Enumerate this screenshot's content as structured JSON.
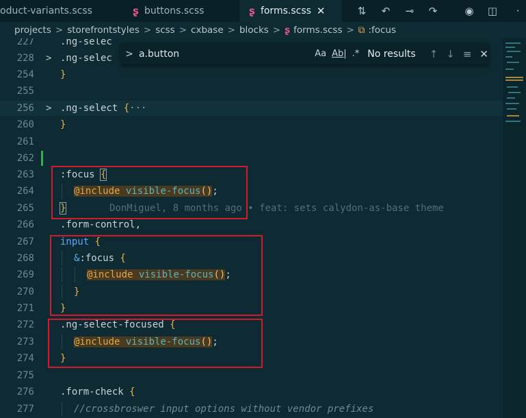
{
  "tabs": [
    {
      "label": "oduct-variants.scss"
    },
    {
      "label": "buttons.scss"
    },
    {
      "label": "forms.scss",
      "close": "✕"
    }
  ],
  "breadcrumb": [
    "projects",
    "storefrontstyles",
    "scss",
    "cxbase",
    "blocks",
    "forms.scss",
    ":focus"
  ],
  "find": {
    "query": "a.button",
    "opt_case": "Aa",
    "opt_word": "Ab|",
    "opt_regex": ".*",
    "results": "No results"
  },
  "lines": {
    "l227": {
      "num": "227",
      "text": ".ng-selec"
    },
    "l228": {
      "num": "228",
      "text": ".ng-selec"
    },
    "l254": {
      "num": "254",
      "text": "}"
    },
    "l255": {
      "num": "255"
    },
    "l256": {
      "num": "256",
      "sel": ".ng-select",
      "rest": " {",
      "ph": "···"
    },
    "l260": {
      "num": "260",
      "text": "}"
    },
    "l261": {
      "num": "261"
    },
    "l262": {
      "num": "262"
    },
    "l263": {
      "num": "263",
      "sel": ":focus",
      "brace": "{"
    },
    "l264": {
      "num": "264",
      "kw": "@include",
      "fn": "visible-focus",
      "paren": "()",
      "semi": ";"
    },
    "l265": {
      "num": "265",
      "brace": "}",
      "blame": "DonMiguel, 8 months ago • feat: sets calydon-as-base theme"
    },
    "l266": {
      "num": "266",
      "text": ".form-control,"
    },
    "l267": {
      "num": "267",
      "tag": "input",
      "brace": "{"
    },
    "l268": {
      "num": "268",
      "amp": "&",
      "sel": ":focus",
      "brace": "{"
    },
    "l269": {
      "num": "269",
      "kw": "@include",
      "fn": "visible-focus",
      "paren": "()",
      "semi": ";"
    },
    "l270": {
      "num": "270",
      "brace": "}"
    },
    "l271": {
      "num": "271",
      "brace": "}"
    },
    "l272": {
      "num": "272",
      "sel": ".ng-select-focused",
      "brace": "{"
    },
    "l273": {
      "num": "273",
      "kw": "@include",
      "fn": "visible-focus",
      "paren": "()",
      "semi": ";"
    },
    "l274": {
      "num": "274",
      "brace": "}"
    },
    "l275": {
      "num": "275"
    },
    "l276": {
      "num": "276",
      "sel": ".form-check",
      "brace": "{"
    },
    "l277": {
      "num": "277",
      "comment": "//crossbroswer input options without vendor prefixes"
    }
  },
  "colors": {
    "background": "#0e2a33",
    "tabbar": "#092028",
    "highlight_box": "#d01c2c",
    "keyword": "#e0a84a",
    "function": "#56b6c2",
    "git_added": "#35b04a"
  },
  "icons": [
    "sass-file-icon",
    "close-icon",
    "split-compare-icon",
    "go-back-icon",
    "commit-icon",
    "go-forward-icon",
    "git-graph-icon",
    "split-editor-icon",
    "more-actions-icon",
    "chevron-right-icon",
    "selector-symbol-icon",
    "fold-chevron-icon",
    "arrow-up-icon",
    "arrow-down-icon",
    "find-in-selection-icon"
  ]
}
